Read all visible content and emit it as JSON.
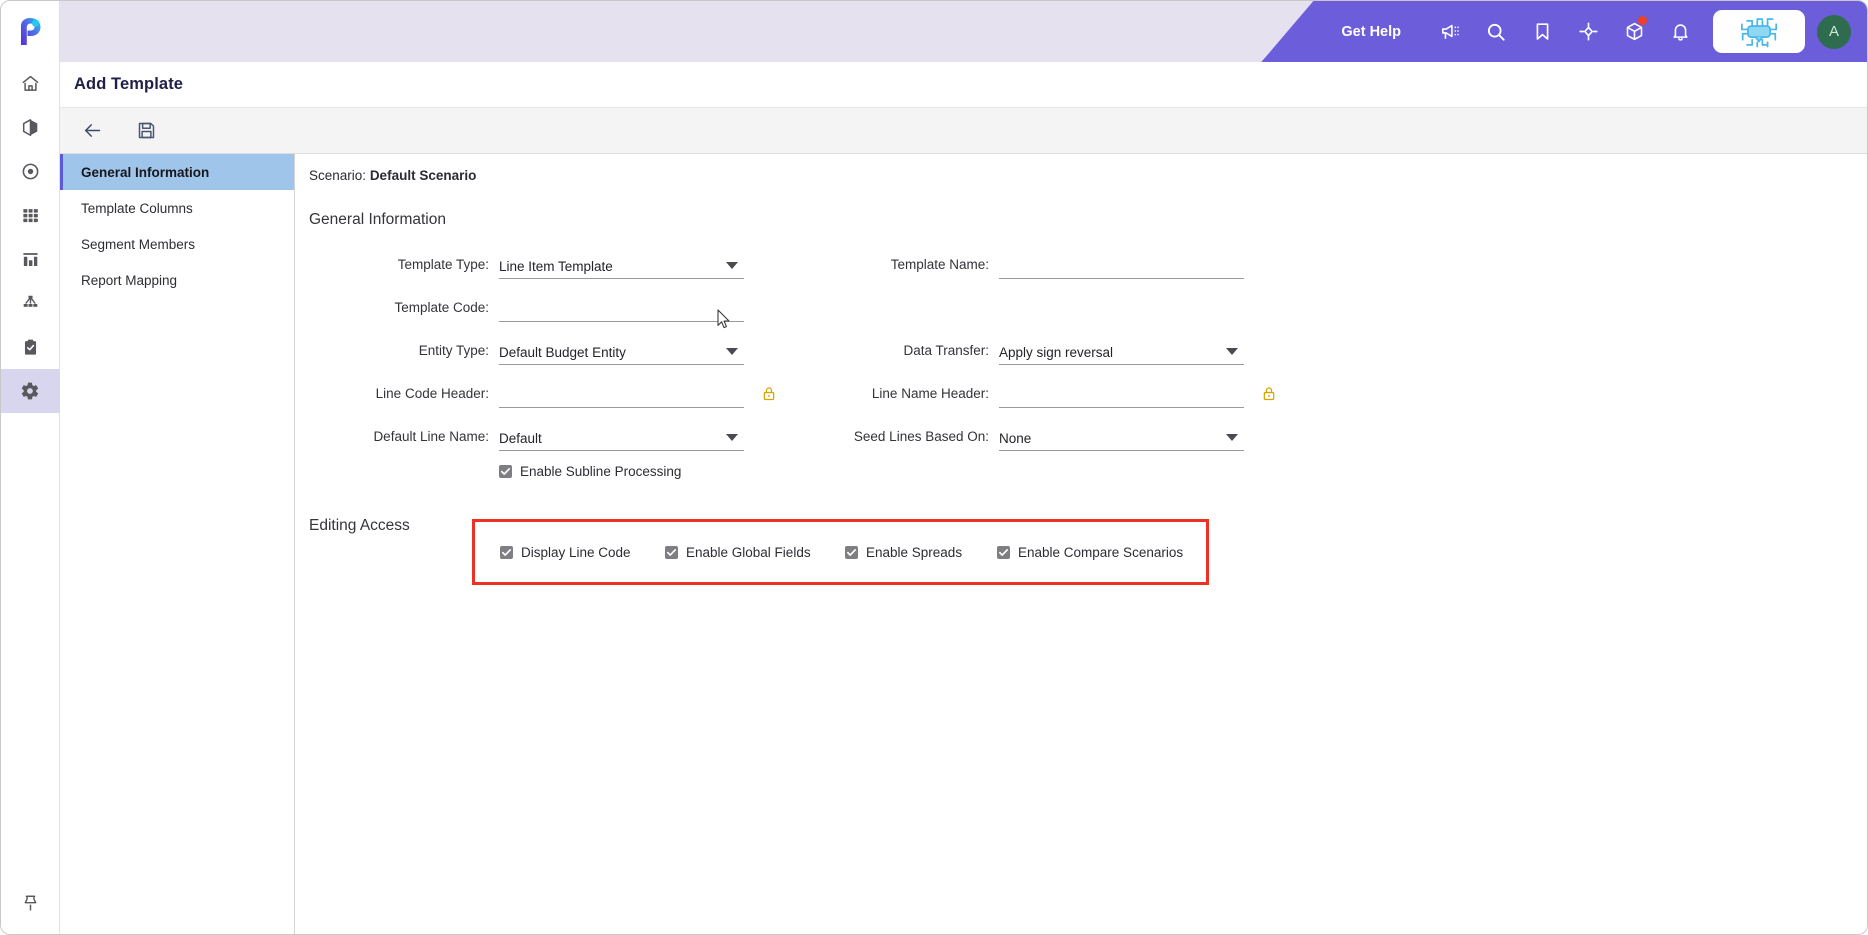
{
  "window": {
    "title": "Add Template"
  },
  "brand": {
    "accent": "#6c5ddb",
    "highlight": "#ee3124",
    "nav_selected": "#9fc5ea"
  },
  "header": {
    "get_help": "Get Help",
    "icons": [
      {
        "name": "announcement-icon"
      },
      {
        "name": "search-icon"
      },
      {
        "name": "bookmark-icon"
      },
      {
        "name": "target-icon"
      },
      {
        "name": "package-icon",
        "badge": true
      },
      {
        "name": "bell-icon"
      }
    ],
    "chip_icon": "ai-chip-icon",
    "avatar_initial": "A"
  },
  "rail": {
    "logo": "p-logo",
    "items": [
      {
        "name": "home-icon",
        "label": "Home",
        "active": false
      },
      {
        "name": "cube-icon",
        "label": "Models",
        "active": false
      },
      {
        "name": "target-record-icon",
        "label": "Targets",
        "active": false
      },
      {
        "name": "grid-icon",
        "label": "Grid",
        "active": false
      },
      {
        "name": "bar-chart-icon",
        "label": "Reports",
        "active": false
      },
      {
        "name": "hierarchy-icon",
        "label": "Hierarchy",
        "active": false
      },
      {
        "name": "clipboard-check-icon",
        "label": "Tasks",
        "active": false
      },
      {
        "name": "gear-icon",
        "label": "Settings",
        "active": true
      }
    ],
    "pin": {
      "name": "pin-icon",
      "label": "Pin"
    }
  },
  "toolbar": {
    "back_label": "Back",
    "save_label": "Save"
  },
  "nav": {
    "items": [
      {
        "label": "General Information",
        "active": true
      },
      {
        "label": "Template Columns",
        "active": false
      },
      {
        "label": "Segment Members",
        "active": false
      },
      {
        "label": "Report Mapping",
        "active": false
      }
    ]
  },
  "form": {
    "scenario_label": "Scenario:",
    "scenario_value": "Default Scenario",
    "section_title": "General Information",
    "fields": {
      "template_type": {
        "label": "Template Type:",
        "value": "Line Item Template",
        "type": "select"
      },
      "template_name": {
        "label": "Template Name:",
        "value": "",
        "type": "text"
      },
      "template_code": {
        "label": "Template Code:",
        "value": "",
        "type": "text"
      },
      "entity_type": {
        "label": "Entity Type:",
        "value": "Default Budget Entity",
        "type": "select"
      },
      "data_transfer": {
        "label": "Data Transfer:",
        "value": "Apply sign reversal",
        "type": "select"
      },
      "line_code_header": {
        "label": "Line Code Header:",
        "value": "",
        "type": "text",
        "lock": "lock-icon"
      },
      "line_name_header": {
        "label": "Line Name Header:",
        "value": "",
        "type": "text",
        "lock": "lock-icon"
      },
      "default_line_name": {
        "label": "Default Line Name:",
        "value": "Default",
        "type": "select"
      },
      "seed_lines_based_on": {
        "label": "Seed Lines Based On:",
        "value": "None",
        "type": "select"
      }
    },
    "subline": {
      "label": "Enable Subline Processing",
      "checked": true
    }
  },
  "editing_access": {
    "title": "Editing Access",
    "checkboxes": [
      {
        "label": "Display Line Code",
        "checked": true
      },
      {
        "label": "Enable Global Fields",
        "checked": true
      },
      {
        "label": "Enable Spreads",
        "checked": true
      },
      {
        "label": "Enable Compare Scenarios",
        "checked": true
      }
    ]
  }
}
